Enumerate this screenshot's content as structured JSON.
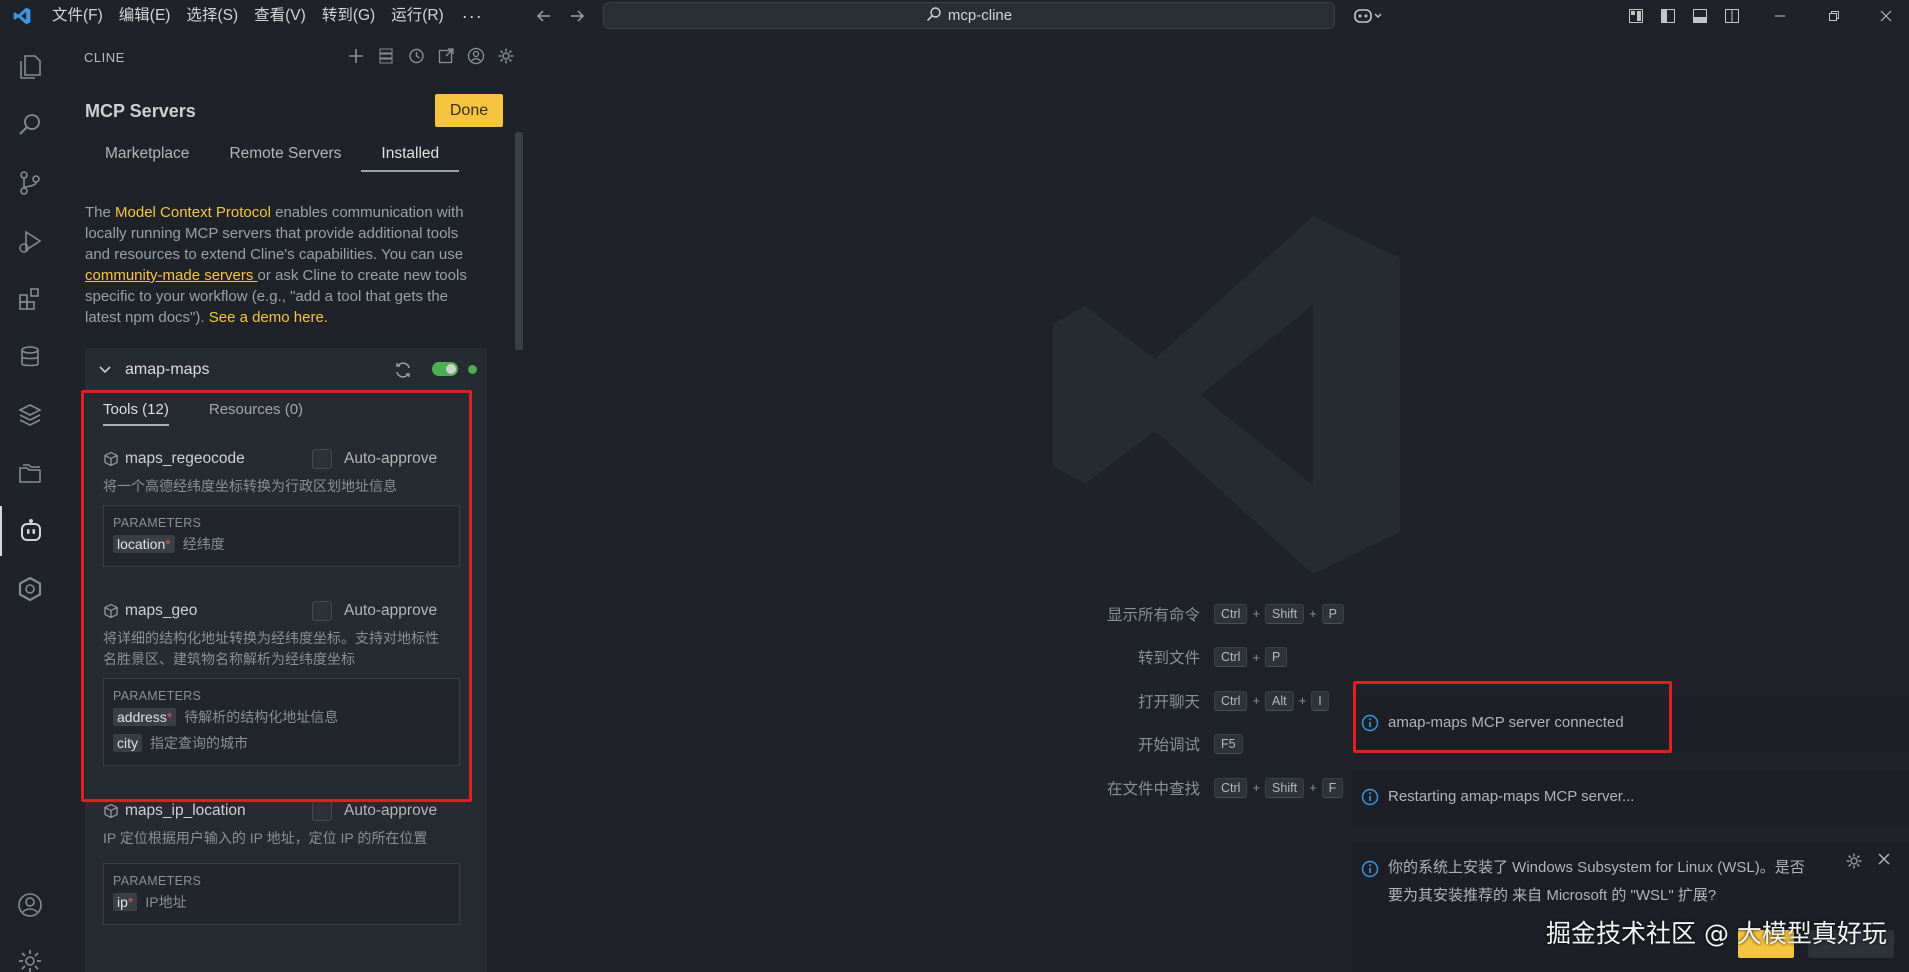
{
  "titlebar": {
    "menus": [
      "文件(F)",
      "编辑(E)",
      "选择(S)",
      "查看(V)",
      "转到(G)",
      "运行(R)"
    ],
    "more": "···",
    "search": "mcp-cline"
  },
  "sidebar": {
    "header": "CLINE",
    "title": "MCP Servers",
    "done_label": "Done",
    "tabs": [
      "Marketplace",
      "Remote Servers",
      "Installed"
    ],
    "active_tab": "Installed",
    "description": {
      "p1": "The ",
      "link1": "Model Context Protocol",
      "p2": " enables communication with locally running MCP servers that provide additional tools and resources to extend Cline's capabilities. You can use ",
      "link2": "community-made servers ",
      "p3": " or ask Cline to create new tools specific to your workflow (e.g., \"add a tool that gets the latest npm docs\"). ",
      "link3": "See a demo here."
    },
    "server": {
      "name": "amap-maps",
      "enabled": true,
      "status_color": "#4caf50",
      "tabs": [
        "Tools (12)",
        "Resources (0)"
      ],
      "tools": [
        {
          "name": "maps_regeocode",
          "auto_approve": "Auto-approve",
          "description": "将一个高德经纬度坐标转换为行政区划地址信息",
          "params_label": "PARAMETERS",
          "params": [
            {
              "name": "location",
              "desc": "经纬度"
            }
          ]
        },
        {
          "name": "maps_geo",
          "auto_approve": "Auto-approve",
          "description_line1": "将详细的结构化地址转换为经纬度坐标。支持对地标性",
          "description_line2": "名胜景区、建筑物名称解析为经纬度坐标",
          "params_label": "PARAMETERS",
          "params": [
            {
              "name": "address",
              "desc": "待解析的结构化地址信息",
              "required": true
            },
            {
              "name": "city",
              "desc": "指定查询的城市",
              "required": false
            }
          ]
        },
        {
          "name": "maps_ip_location",
          "auto_approve": "Auto-approve",
          "description": "IP 定位根据用户输入的 IP 地址，定位 IP 的所在位置",
          "params_label": "PARAMETERS",
          "params": [
            {
              "name": "ip",
              "desc": "IP地址"
            }
          ]
        }
      ]
    }
  },
  "editor": {
    "shortcuts": [
      {
        "label": "显示所有命令",
        "keys": [
          "Ctrl",
          "Shift",
          "P"
        ]
      },
      {
        "label": "转到文件",
        "keys": [
          "Ctrl",
          "P"
        ]
      },
      {
        "label": "打开聊天",
        "keys": [
          "Ctrl",
          "Alt",
          "I"
        ]
      },
      {
        "label": "开始调试",
        "keys": [
          "F5"
        ]
      },
      {
        "label": "在文件中查找",
        "keys": [
          "Ctrl",
          "Shift",
          "F"
        ]
      }
    ]
  },
  "notifications": [
    {
      "text": "amap-maps MCP server connected"
    },
    {
      "text": "Restarting amap-maps MCP server..."
    },
    {
      "line1": "你的系统上安装了 Windows Subsystem for Linux (WSL)。是否",
      "line2": "要为其安装推荐的 来自 Microsoft 的 \"WSL\" 扩展?"
    }
  ],
  "watermark": "掘金技术社区 @ 大模型真好玩",
  "colors": {
    "accent": "#f5c541",
    "highlight_box": "#e02020",
    "background": "#1f2329"
  }
}
